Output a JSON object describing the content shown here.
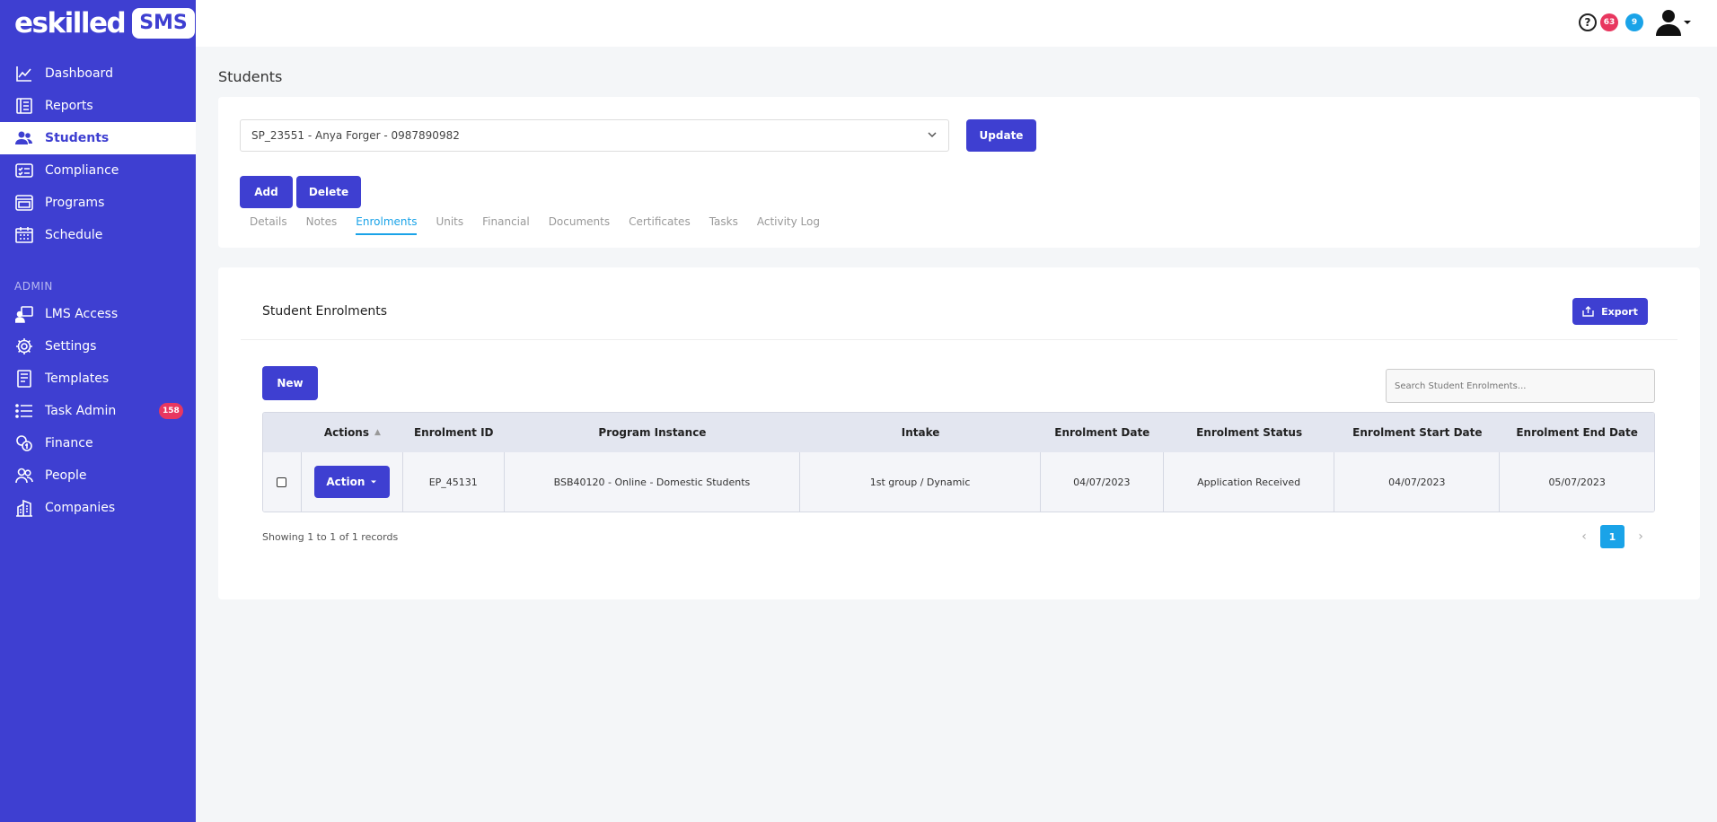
{
  "brand": {
    "word": "eskilled",
    "badge": "SMS"
  },
  "sidebar": {
    "items": [
      {
        "label": "Dashboard",
        "icon": "chart-line-icon"
      },
      {
        "label": "Reports",
        "icon": "report-icon"
      },
      {
        "label": "Students",
        "icon": "users-icon",
        "active": true
      },
      {
        "label": "Compliance",
        "icon": "checklist-icon"
      },
      {
        "label": "Programs",
        "icon": "browser-icon"
      },
      {
        "label": "Schedule",
        "icon": "calendar-icon"
      }
    ],
    "section_label": "ADMIN",
    "admin_items": [
      {
        "label": "LMS Access",
        "icon": "user-screen-icon"
      },
      {
        "label": "Settings",
        "icon": "gear-icon"
      },
      {
        "label": "Templates",
        "icon": "document-icon"
      },
      {
        "label": "Task Admin",
        "icon": "list-icon",
        "badge": "158"
      },
      {
        "label": "Finance",
        "icon": "coins-icon"
      },
      {
        "label": "People",
        "icon": "people-icon"
      },
      {
        "label": "Companies",
        "icon": "building-icon"
      }
    ]
  },
  "topbar": {
    "help": "?",
    "notifications_red": "63",
    "notifications_blue": "9"
  },
  "page": {
    "title": "Students"
  },
  "student_select": {
    "value": "SP_23551 - Anya Forger - 0987890982"
  },
  "buttons": {
    "update": "Update",
    "add": "Add",
    "delete": "Delete",
    "export": "Export",
    "new": "New",
    "action": "Action"
  },
  "tabs": [
    "Details",
    "Notes",
    "Enrolments",
    "Units",
    "Financial",
    "Documents",
    "Certificates",
    "Tasks",
    "Activity Log"
  ],
  "active_tab": "Enrolments",
  "enrolments": {
    "title": "Student Enrolments",
    "search_placeholder": "Search Student Enrolments...",
    "columns": [
      "",
      "Actions",
      "Enrolment ID",
      "Program Instance",
      "Intake",
      "Enrolment Date",
      "Enrolment Status",
      "Enrolment Start Date",
      "Enrolment End Date"
    ],
    "rows": [
      {
        "id": "EP_45131",
        "program": "BSB40120 - Online - Domestic Students",
        "intake": "1st group / Dynamic",
        "enrolment_date": "04/07/2023",
        "status": "Application Received",
        "start_date": "04/07/2023",
        "end_date": "05/07/2023"
      }
    ],
    "showing": "Showing 1 to 1 of 1 records",
    "current_page": "1"
  },
  "colors": {
    "brand": "#3e3fd1",
    "accent": "#1aa3e8",
    "badge_red": "#e8375f"
  }
}
